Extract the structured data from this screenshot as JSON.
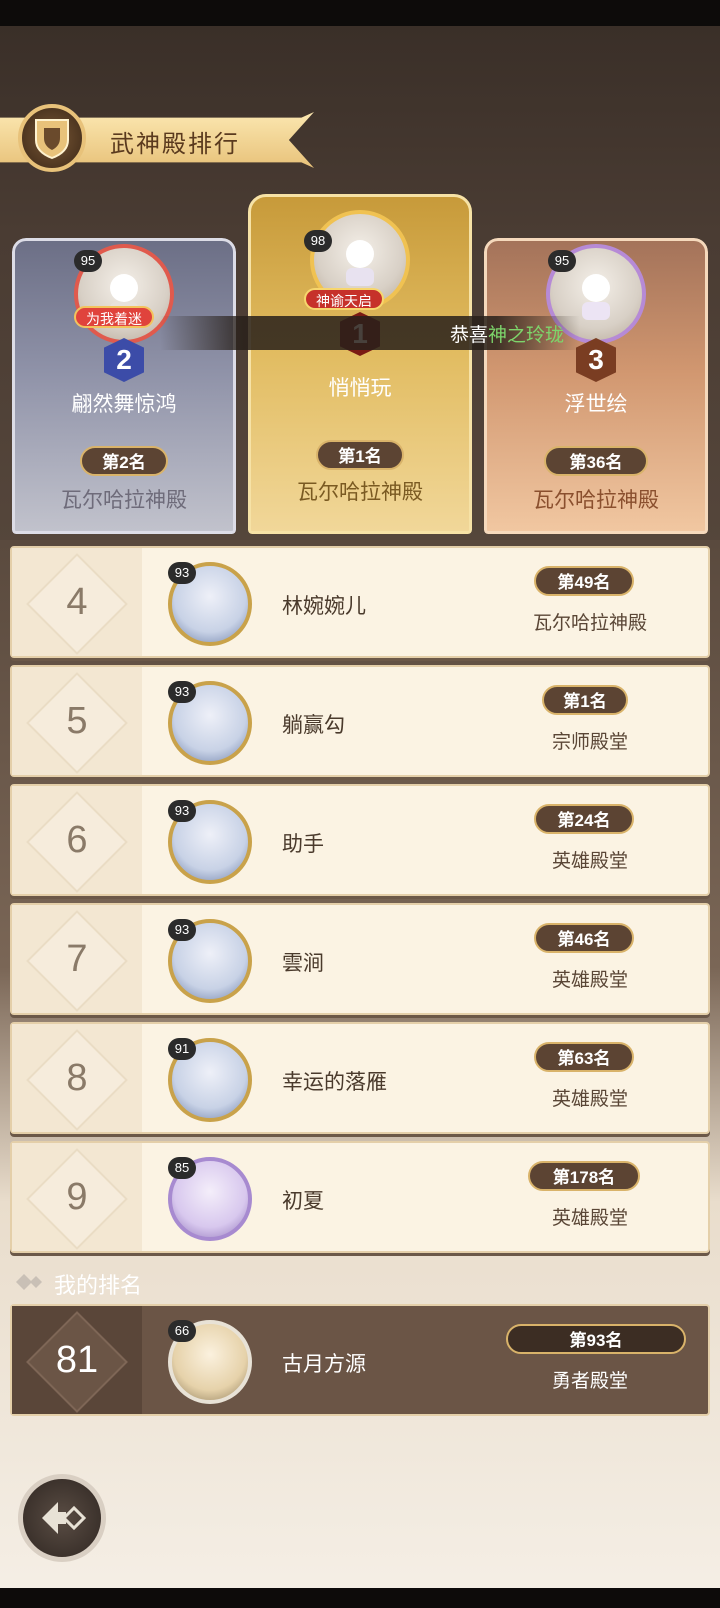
{
  "header": {
    "title": "武神殿排行"
  },
  "marquee": {
    "prefix": "恭喜",
    "highlight": "神之玲珑"
  },
  "podium": [
    {
      "rank": "2",
      "level": "95",
      "badge": "为我着迷",
      "name": "翩然舞惊鸿",
      "place": "第2名",
      "hall": "瓦尔哈拉神殿"
    },
    {
      "rank": "1",
      "level": "98",
      "badge": "神谕天启",
      "name": "悄悄玩",
      "place": "第1名",
      "hall": "瓦尔哈拉神殿"
    },
    {
      "rank": "3",
      "level": "95",
      "badge": "",
      "name": "浮世绘",
      "place": "第36名",
      "hall": "瓦尔哈拉神殿"
    }
  ],
  "rows": [
    {
      "rank": "4",
      "level": "93",
      "name": "林婉婉儿",
      "place": "第49名",
      "hall": "瓦尔哈拉神殿"
    },
    {
      "rank": "5",
      "level": "93",
      "name": "躺赢勾",
      "place": "第1名",
      "hall": "宗师殿堂"
    },
    {
      "rank": "6",
      "level": "93",
      "name": "助手",
      "place": "第24名",
      "hall": "英雄殿堂"
    },
    {
      "rank": "7",
      "level": "93",
      "name": "雲涧",
      "place": "第46名",
      "hall": "英雄殿堂"
    },
    {
      "rank": "8",
      "level": "91",
      "name": "幸运的落雁",
      "place": "第63名",
      "hall": "英雄殿堂"
    },
    {
      "rank": "9",
      "level": "85",
      "name": "初夏",
      "place": "第178名",
      "hall": "英雄殿堂"
    }
  ],
  "my_rank": {
    "label": "我的排名",
    "rank": "81",
    "level": "66",
    "name": "古月方源",
    "place": "第93名",
    "hall": "勇者殿堂"
  },
  "icons": {
    "header_emblem": "shield-emblem-icon",
    "back": "back-arrow-icon",
    "my_rank": "diamond-arrow-icon"
  },
  "colors": {
    "gold": "#e8c27a",
    "silver_card": "#8f92a8",
    "gold_card": "#e1bb5f",
    "bronze_card": "#d19770",
    "row_bg": "#fbf3e3",
    "my_row_bg": "#6b5546",
    "place_badge": "#5c4433",
    "highlight_green": "#7dd56b"
  }
}
